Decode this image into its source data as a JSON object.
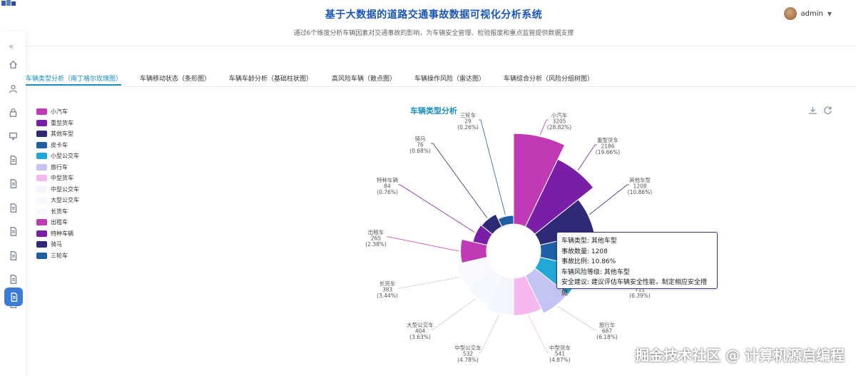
{
  "header": {
    "title": "基于大数据的道路交通事故数据可视化分析系统",
    "subtitle": "通过6个维度分析车辆因素对交通事故的影响，为车辆安全管理、检验报废和重点监管提供数据支撑",
    "user": "admin"
  },
  "tabs": [
    {
      "label": "车辆类型分析（南丁格尔玫瑰图）",
      "active": true
    },
    {
      "label": "车辆移动状态（条形图）",
      "active": false
    },
    {
      "label": "车辆车龄分析（基础柱状图）",
      "active": false
    },
    {
      "label": "高风险车辆（散点图）",
      "active": false
    },
    {
      "label": "车辆操作风险（雷达图）",
      "active": false
    },
    {
      "label": "车辆综合分析（风险分组树图）",
      "active": false
    }
  ],
  "chart_data": {
    "type": "pie",
    "subtype": "nightingale-rose",
    "title": "车辆类型分析",
    "legend_position": "left",
    "categories": [
      "小汽车",
      "重型货车",
      "其他车型",
      "皮卡车",
      "小型公交车",
      "旅行车",
      "中型货车",
      "中型公交车",
      "大型公交车",
      "长货车",
      "出租车",
      "特种车辆",
      "骑马",
      "三轮车"
    ],
    "values": [
      3205,
      2186,
      1208,
      711,
      711,
      687,
      541,
      532,
      404,
      383,
      265,
      84,
      76,
      29
    ],
    "percent_labels": [
      "(28.82%)",
      "(19.66%)",
      "(10.86%)",
      "(6.39%)",
      "(6.39%)",
      "(6.18%)",
      "(4.87%)",
      "(4.78%)",
      "(3.63%)",
      "(3.44%)",
      "(2.38%)",
      "(0.76%)",
      "(0.68%)",
      "(0.26%)"
    ],
    "colors": [
      "#c13ab5",
      "#7a1ea8",
      "#2e2a78",
      "#1f5fa6",
      "#22a8d6",
      "#c4c4f4",
      "#f4b8ee",
      "#f3f5ff",
      "#f6f8ff",
      "#f8f9ff",
      "#c13ab5",
      "#7a1ea8",
      "#2e2a78",
      "#1f5fa6"
    ],
    "labels_visible": [
      true,
      true,
      true,
      false,
      true,
      true,
      true,
      true,
      true,
      true,
      true,
      true,
      true,
      true
    ]
  },
  "tooltip": {
    "line1": "车辆类型: 其他车型",
    "line2": "事故数量: 1208",
    "line3": "事故比例: 10.86%",
    "line4": "车辆风险等级: 其他车型",
    "line5": "安全建议: 建议评估车辆安全性能，制定相应安全措施"
  },
  "sidebar": {
    "icons": [
      "home-icon",
      "user-icon",
      "lock-icon",
      "monitor-icon",
      "document-icon",
      "document-icon",
      "document-icon",
      "document-icon",
      "document-icon",
      "document-icon",
      "document-icon"
    ],
    "active_icon": "document-icon"
  },
  "watermark": "掘金技术社区 @ 计算机源启编程"
}
